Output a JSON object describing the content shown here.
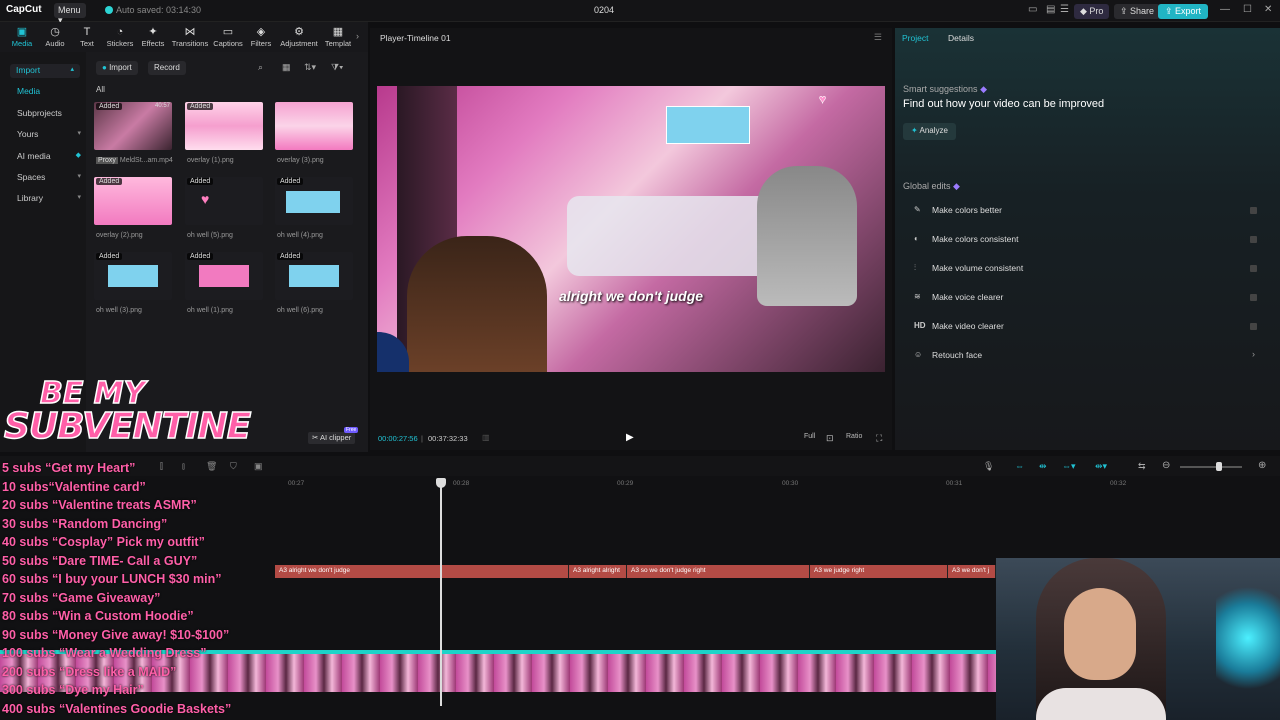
{
  "app": {
    "logo": "CapCut",
    "menu": "Menu",
    "autosave": "Auto saved: 03:14:30",
    "project_name": "0204"
  },
  "titlebar": {
    "pro": "Pro",
    "share": "Share",
    "export": "Export"
  },
  "toolbar": [
    "Media",
    "Audio",
    "Text",
    "Stickers",
    "Effects",
    "Transitions",
    "Captions",
    "Filters",
    "Adjustment",
    "Templat"
  ],
  "leftnav": {
    "import": "Import",
    "items": [
      "Media",
      "Subprojects",
      "Yours",
      "AI media",
      "Spaces",
      "Library"
    ]
  },
  "media": {
    "import": "Import",
    "record": "Record",
    "all": "All",
    "thumbs": [
      {
        "tag": "Added",
        "label": "MeldSt...am.mp4",
        "extra": "Proxy",
        "time": "40:57"
      },
      {
        "tag": "Added",
        "label": "overlay (1).png"
      },
      {
        "tag": "",
        "label": "overlay (3).png"
      },
      {
        "tag": "Added",
        "label": "overlay (2).png"
      },
      {
        "tag": "Added",
        "label": "oh well (5).png"
      },
      {
        "tag": "Added",
        "label": "oh well (4).png"
      },
      {
        "tag": "Added",
        "label": "oh well (3).png"
      },
      {
        "tag": "Added",
        "label": "oh well (1).png"
      },
      {
        "tag": "Added",
        "label": "oh well (6).png"
      }
    ],
    "ai_clipper": "AI clipper",
    "free": "Free"
  },
  "overlay": {
    "line1": "BE MY",
    "line2": "SUBVENTINE"
  },
  "player": {
    "title": "Player-Timeline 01",
    "caption": "alright we don't judge",
    "timecode": "00:00:27:56",
    "duration": "00:37:32:33",
    "controls": [
      "Full",
      "Ratio"
    ]
  },
  "rpanel": {
    "tabs": [
      "Project",
      "Details"
    ],
    "smart_label": "Smart suggestions",
    "smart_title": "Find out how your video can be improved",
    "analyze": "Analyze",
    "global_label": "Global edits",
    "edits": [
      "Make colors better",
      "Make colors consistent",
      "Make volume consistent",
      "Make voice clearer",
      "Make video clearer",
      "Retouch face"
    ],
    "hd_icon_text": "HD"
  },
  "timeline": {
    "ruler": [
      "00:27",
      "00:28",
      "00:29",
      "00:30",
      "00:31",
      "00:32"
    ],
    "text_clips": [
      "A3 alright we don't judge",
      "A3 alright alright",
      "A3 so we don't judge right",
      "A3 we judge right",
      "A3 we don't j"
    ]
  },
  "subs_goals": [
    "5 subs “Get my Heart”",
    "10 subs“Valentine card”",
    "20 subs “Valentine treats ASMR”",
    "30 subs “Random Dancing”",
    "40 subs “Cosplay” Pick my outfit”",
    "50 subs “Dare TIME- Call a GUY”",
    "60 subs “I buy your LUNCH $30 min”",
    "70 subs “Game Giveaway”",
    "80 subs “Win a Custom Hoodie”",
    "90 subs “Money Give away! $10-$100”",
    "100 subs “Wear a Wedding Dress”",
    "200 subs “Dress like a MAID”",
    "300 subs “Dye my Hair”",
    "400 subs “Valentines Goodie Baskets”"
  ],
  "colors": {
    "accent": "#21c3d4",
    "export": "#21b5c4",
    "caption_clip": "#b34b45",
    "goal_text": "#ff5fa8"
  }
}
